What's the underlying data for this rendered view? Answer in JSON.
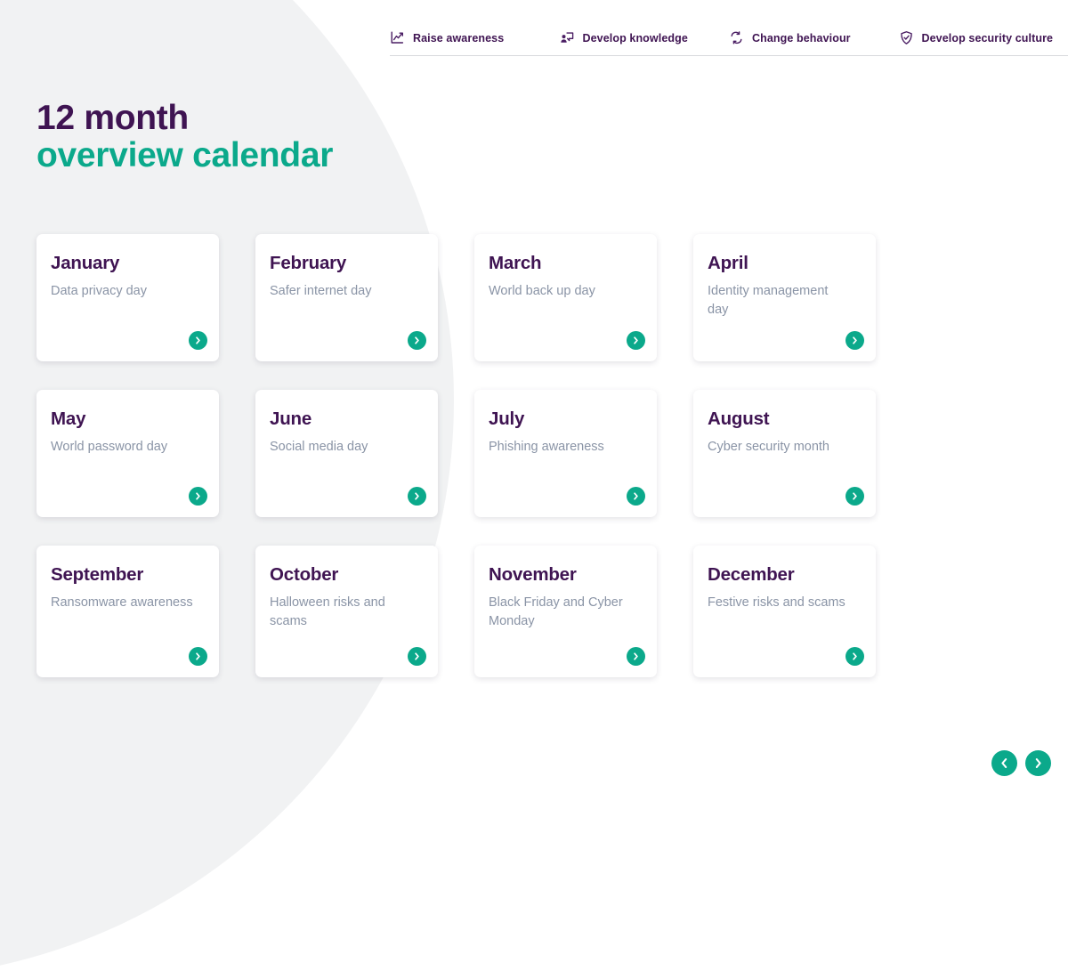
{
  "theme": {
    "purple": "#3f1452",
    "teal": "#0ba98b",
    "muted_text": "#8a94a6",
    "bg_circle": "#f1f2f3",
    "page_bg": "#ffffff"
  },
  "topnav": {
    "tabs": [
      {
        "label": "Raise awareness",
        "icon": "line-chart-icon"
      },
      {
        "label": "Develop knowledge",
        "icon": "person-presentation-icon"
      },
      {
        "label": "Change behaviour",
        "icon": "refresh-cycle-icon"
      },
      {
        "label": "Develop security culture",
        "icon": "shield-check-icon"
      }
    ]
  },
  "heading": {
    "line1": "12 month",
    "line2": "overview calendar"
  },
  "calendar": {
    "rows": [
      [
        {
          "month": "January",
          "theme": "Data privacy day",
          "arrow": "chevron-right-icon"
        },
        {
          "month": "February",
          "theme": "Safer internet day",
          "arrow": "chevron-right-icon"
        },
        {
          "month": "March",
          "theme": "World back up day",
          "arrow": "chevron-right-icon"
        },
        {
          "month": "April",
          "theme": "Identity management day",
          "arrow": "chevron-right-icon"
        }
      ],
      [
        {
          "month": "May",
          "theme": "World password day",
          "arrow": "chevron-right-icon"
        },
        {
          "month": "June",
          "theme": "Social media day",
          "arrow": "chevron-right-icon"
        },
        {
          "month": "July",
          "theme": "Phishing awareness",
          "arrow": "chevron-right-icon"
        },
        {
          "month": "August",
          "theme": "Cyber security month",
          "arrow": "chevron-right-icon"
        }
      ],
      [
        {
          "month": "September",
          "theme": "Ransomware awareness",
          "arrow": "chevron-right-icon"
        },
        {
          "month": "October",
          "theme": "Halloween risks and scams",
          "arrow": "chevron-right-icon"
        },
        {
          "month": "November",
          "theme": "Black Friday and Cyber Monday",
          "arrow": "chevron-right-icon"
        },
        {
          "month": "December",
          "theme": "Festive risks and scams",
          "arrow": "chevron-right-icon"
        }
      ]
    ]
  },
  "pager": {
    "prev_icon": "chevron-left-icon",
    "next_icon": "chevron-right-icon"
  }
}
